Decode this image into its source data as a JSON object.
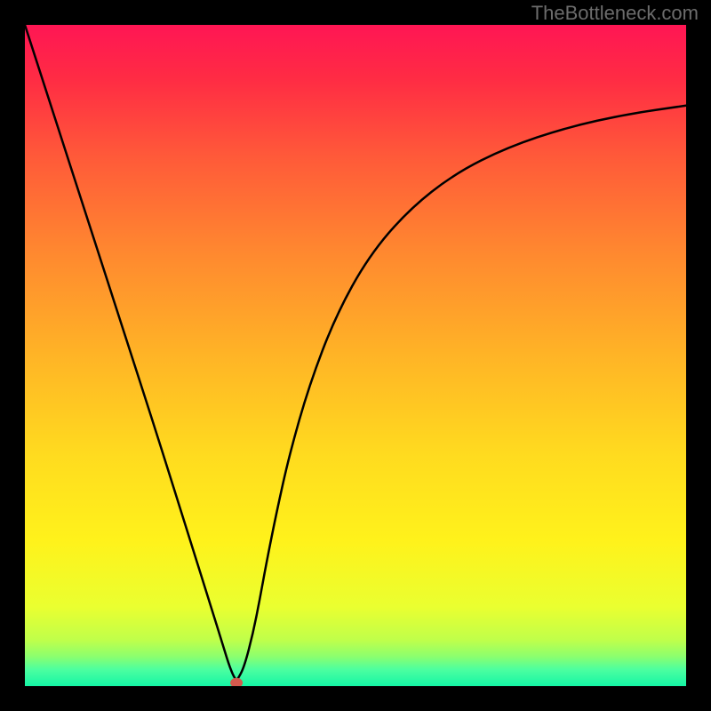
{
  "watermark": "TheBottleneck.com",
  "chart_data": {
    "type": "line",
    "title": "",
    "xlabel": "",
    "ylabel": "",
    "xlim": [
      0,
      1
    ],
    "ylim": [
      0,
      1
    ],
    "background_gradient": {
      "stops": [
        {
          "offset": 0.0,
          "color": "#ff1654"
        },
        {
          "offset": 0.08,
          "color": "#ff2b44"
        },
        {
          "offset": 0.2,
          "color": "#ff5a39"
        },
        {
          "offset": 0.35,
          "color": "#ff8a2f"
        },
        {
          "offset": 0.5,
          "color": "#ffb426"
        },
        {
          "offset": 0.65,
          "color": "#ffdb1f"
        },
        {
          "offset": 0.78,
          "color": "#fff21b"
        },
        {
          "offset": 0.88,
          "color": "#eaff30"
        },
        {
          "offset": 0.93,
          "color": "#c0ff4a"
        },
        {
          "offset": 0.955,
          "color": "#8cff6e"
        },
        {
          "offset": 0.975,
          "color": "#4cffa0"
        },
        {
          "offset": 1.0,
          "color": "#14f5a5"
        }
      ]
    },
    "series": [
      {
        "name": "bottleneck-curve",
        "x": [
          0.0,
          0.05,
          0.1,
          0.15,
          0.2,
          0.25,
          0.28,
          0.3,
          0.31,
          0.318,
          0.322,
          0.332,
          0.345,
          0.355,
          0.365,
          0.38,
          0.4,
          0.43,
          0.47,
          0.52,
          0.58,
          0.65,
          0.73,
          0.82,
          0.91,
          1.0
        ],
        "y": [
          1.0,
          0.845,
          0.69,
          0.535,
          0.38,
          0.22,
          0.125,
          0.06,
          0.028,
          0.01,
          0.01,
          0.03,
          0.08,
          0.13,
          0.185,
          0.26,
          0.35,
          0.455,
          0.56,
          0.65,
          0.72,
          0.775,
          0.815,
          0.845,
          0.865,
          0.878
        ]
      }
    ],
    "marker": {
      "x": 0.32,
      "y": 0.005,
      "color": "#d45a4e",
      "name": "minimum-point"
    }
  }
}
